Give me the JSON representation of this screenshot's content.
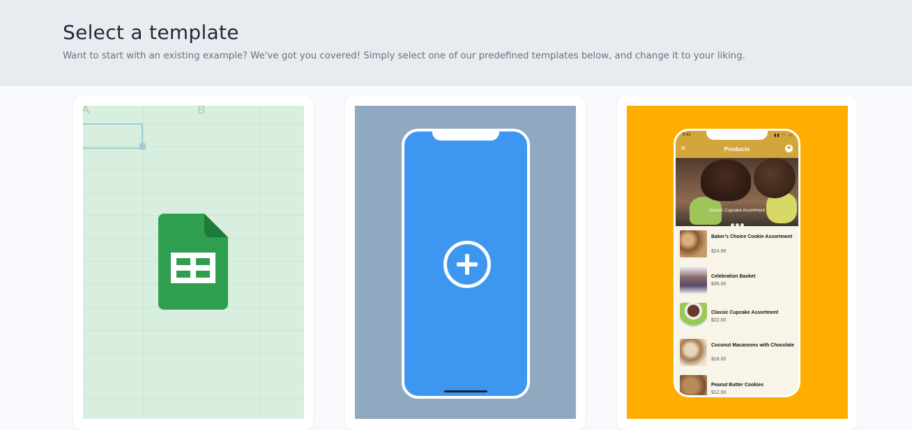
{
  "header": {
    "title": "Select a template",
    "subtitle": "Want to start with an existing example? We've got you covered! Simply select one of our predefined templates below, and change it to your liking."
  },
  "templates": {
    "sheets": {
      "col_a": "A",
      "col_b": "B",
      "icon": "google-sheets-icon",
      "color": "#2f9e4f"
    },
    "new_app": {
      "icon": "plus-circle-icon",
      "color": "#3d97f1"
    },
    "products": {
      "status_time": "9:41",
      "app_title": "Products",
      "hero_caption": "Classic Cupcake Assortment",
      "items": [
        {
          "name": "Baker's Choice Cookie Assortment",
          "price": "$24.99"
        },
        {
          "name": "Celebration Basket",
          "price": "$35.00"
        },
        {
          "name": "Classic Cupcake Assortment",
          "price": "$22.00"
        },
        {
          "name": "Coconut Macaroons with Chocolate",
          "price": "$18.00"
        },
        {
          "name": "Peanut Butter Cookies",
          "price": "$12.00"
        }
      ]
    }
  }
}
